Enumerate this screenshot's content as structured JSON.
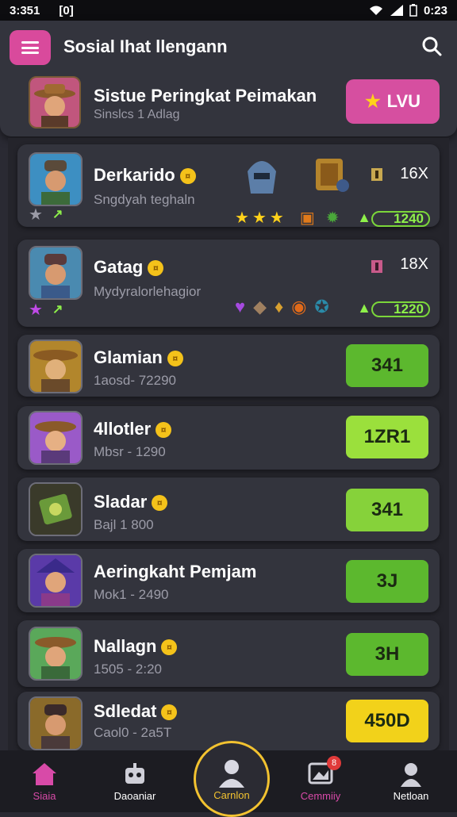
{
  "status": {
    "time_left": "3:351",
    "extra": "[0]",
    "time_right": "0:23"
  },
  "header": {
    "title": "Sosial Ihat llengann",
    "menu_icon": "menu-icon",
    "search_icon": "search-icon"
  },
  "profile": {
    "title": "Sistue Peringkat Peimakan",
    "subtitle": "Sinslcs 1 Adlag",
    "level_label": "LVU"
  },
  "players": [
    {
      "name": "Derkarido",
      "sub": "Sngdyah teghaln",
      "mult": "16X",
      "pill": "1240"
    },
    {
      "name": "Gatag",
      "sub": "Mydyralorlehagior",
      "mult": "18X",
      "pill": "1220"
    },
    {
      "name": "Glamian",
      "sub": "1aosd- 72290",
      "score": "341"
    },
    {
      "name": "4llotler",
      "sub": "Mbsr - 1290",
      "score": "1ZR1"
    },
    {
      "name": "Sladar",
      "sub": "Bajl 1 800",
      "score": "341"
    },
    {
      "name": "Aeringkaht Pemjam",
      "sub": "Mok1 - 2490",
      "score": "3J"
    },
    {
      "name": "Nallagn",
      "sub": "1505 - 2:20",
      "score": "3H"
    },
    {
      "name": "Sdledat",
      "sub": "Caol0 - 2a5T",
      "score": "450D"
    }
  ],
  "nav": [
    {
      "label": "Siaia",
      "icon": "home-icon"
    },
    {
      "label": "Daoaniar",
      "icon": "robot-icon"
    },
    {
      "label": "Carnlon",
      "icon": "group-icon"
    },
    {
      "label": "Cemmiiy",
      "icon": "image-icon",
      "badge": "8"
    },
    {
      "label": "Netloan",
      "icon": "user-icon"
    }
  ],
  "colors": {
    "accent_pink": "#d64fa0",
    "green": "#5cb82e",
    "lime": "#9be03c",
    "yellow": "#f2d21a"
  }
}
